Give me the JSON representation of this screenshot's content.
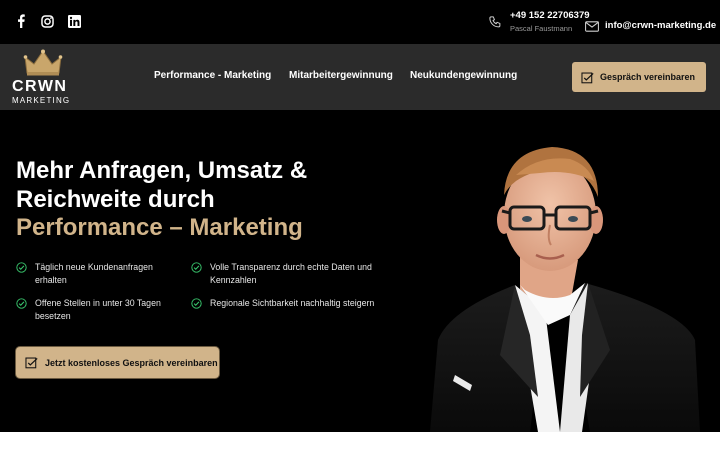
{
  "topbar": {
    "social": [
      {
        "name": "facebook-icon"
      },
      {
        "name": "instagram-icon"
      },
      {
        "name": "linkedin-icon"
      }
    ],
    "phone": "+49 152 22706379",
    "phone_name": "Pascal Faustmann",
    "email": "info@crwn-marketing.de"
  },
  "logo": {
    "word": "CRWN",
    "sub": "MARKETING"
  },
  "nav": {
    "items": [
      {
        "label": "Performance - Marketing"
      },
      {
        "label": "Mitarbeitergewinnung"
      },
      {
        "label": "Neukundengewinnung"
      }
    ],
    "cta": "Gespräch vereinbaren"
  },
  "hero": {
    "headline_line1": "Mehr Anfragen, Umsatz &",
    "headline_line2": "Reichweite durch",
    "headline_accent": "Performance – Marketing",
    "features": [
      {
        "line1": "Täglich neue Kundenanfragen",
        "line2": "erhalten"
      },
      {
        "line1": "Volle Transparenz durch echte Daten und",
        "line2": "Kennzahlen"
      },
      {
        "line1": "Offene Stellen in unter 30 Tagen",
        "line2": "besetzen"
      },
      {
        "line1": "Regionale Sichtbarkeit nachhaltig steigern",
        "line2": ""
      }
    ],
    "cta": "Jetzt kostenloses Gespräch vereinbaren"
  },
  "colors": {
    "accent": "#d1b48a",
    "check": "#39c66d",
    "navbar": "#2b2b2b",
    "background": "#000000"
  }
}
